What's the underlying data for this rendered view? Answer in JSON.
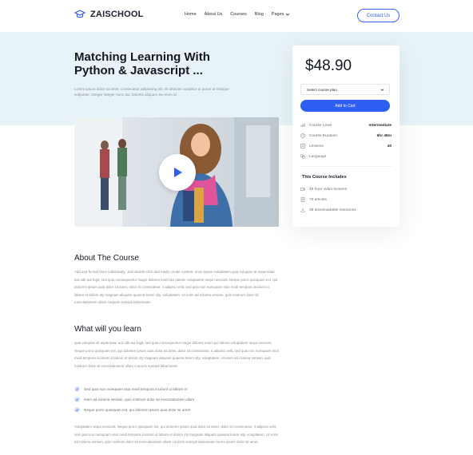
{
  "brand": {
    "name": "ZAISCHOOL",
    "accent": "#2f5ef3",
    "hero_bg": "#e8f3f9"
  },
  "nav": {
    "items": [
      {
        "label": "Home"
      },
      {
        "label": "About Us"
      },
      {
        "label": "Courses"
      },
      {
        "label": "Blog"
      },
      {
        "label": "Pages"
      }
    ],
    "contact_label": "Contact Us"
  },
  "course": {
    "title": "Matching Learning With Python & Javascript ...",
    "intro": "Lorem ipsum dolor sit amet, consectetur adipiscing elit. Et ultricies curabitur ut purus at tristique vulputate. Integer integer nunc dui, lobortis aliquam leo enim id."
  },
  "card": {
    "price": "$48.90",
    "select_placeholder": "Select course plan",
    "cart_label": "Add to Cart",
    "meta": [
      {
        "icon": "bar-chart-icon",
        "label": "Course Level",
        "value": "Intermediate"
      },
      {
        "icon": "clock-icon",
        "label": "Course Duration",
        "value": "6hr 48m"
      },
      {
        "icon": "lessons-icon",
        "label": "Lessons",
        "value": "40"
      },
      {
        "icon": "language-icon",
        "label": "Language",
        "value": ""
      }
    ],
    "includes_title": "This Course Includes",
    "includes": [
      {
        "icon": "video-icon",
        "label": "45 hour video lectures"
      },
      {
        "icon": "article-icon",
        "label": "73 articles"
      },
      {
        "icon": "download-icon",
        "label": "38 downloadable resources"
      }
    ]
  },
  "about": {
    "heading": "About The Course",
    "body": "Add and format them individually. Just double-click and easily create content. enim ipsam voluptatem quia voluptas sit aspernatur aut odit aut fugit, sed quia consequuntur magni dolores eosrt qui ratione voluptatem sequi nesciunt. Neque porro quisquam est, qui dolorem ipsum quia dolor sit amet, dolor sit consectetur, it adipisci velit, sed quia non numquam eius modi tempora incidunt ut labore et dolore sty magnam aliquam quaerat lorem sity. voluptatem. Ut enim ad minima veniam, quis nostrum dolor sit exercitationem ullam corporis suscipit laboriosam"
  },
  "learn": {
    "heading": "What will you learn",
    "body": "quia voluptas sit aspernatur aut odit aut fugit, sed quia consequuntur magni dolores eosrt qui ratione voluptatem sequi nesciunt. Neque porro quisquam est, qui dolorem ipsum quia dolor sit amet, dolor sit consectetur, it adipisci velit, sed quia non numquam eius modi tempora incidunt ut labore et dolore sty magnam aliquam quaerat lorem sity. voluptatem. Ut enim ad minima veniam, quis nostrum dolor sit exercitationem ullam corporis suscipit laboriosam",
    "points": [
      "Sed quia non numquam eius modi tempora incidunt ut labore et",
      "enim ad minima veniam, quis nostrum dolor sit exercitationem ullam",
      "Neque porro quisquam est, qui dolorem ipsum quia dolor sit amet"
    ],
    "footer": "Voluptatem sequi nesciunt. Neque porro quisquam est, qui dolorem ipsum quia dolor sit amet, dolor sit consectetur, it adipisci velit, sed quia non numquam eius modi tempora incidunt ut labore et dolore sty magnam aliquam quaerat lorem sity. voluptatem. Ut enim ad minima veniam, quis nostrum dolor sit exercitationem ullam corporis suscipit laboriosam lorem ipsum dolor sit amet."
  }
}
